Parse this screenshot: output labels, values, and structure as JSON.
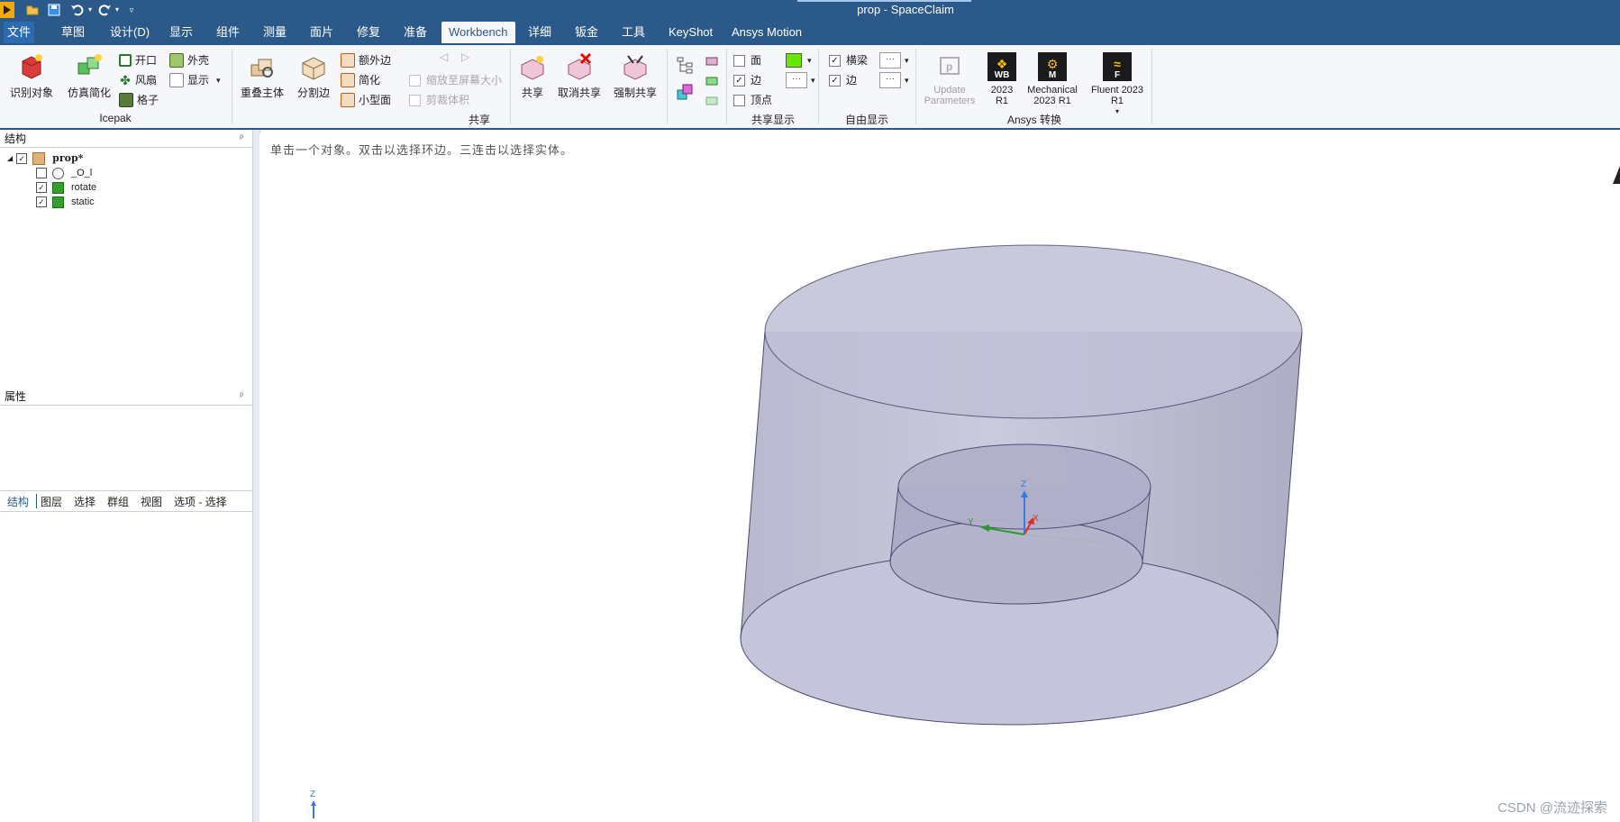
{
  "window": {
    "title": "prop - SpaceClaim"
  },
  "quick_access": [
    "open-icon",
    "save-icon",
    "undo-icon",
    "redo-icon",
    "customize-icon"
  ],
  "menu": {
    "tabs": [
      "文件",
      "草图",
      "设计(D)",
      "显示",
      "组件",
      "测量",
      "面片",
      "修复",
      "准备",
      "Workbench",
      "详细",
      "钣金",
      "工具",
      "KeyShot",
      "Ansys Motion"
    ],
    "active": "Workbench"
  },
  "ribbon": {
    "icepak": {
      "label": "Icepak",
      "identify": "识别对象",
      "simplify": "仿真简化",
      "opening": "开口",
      "fan": "风扇",
      "grille": "格子",
      "enclosure": "外壳",
      "display": "显示"
    },
    "share": {
      "label": "共享",
      "overlap": "重叠主体",
      "split_edge": "分割边",
      "extra_edge": "额外边",
      "simplify": "简化",
      "small_face": "小型面",
      "shrink": "缩放至屏幕大小",
      "clip": "剪裁体积",
      "share": "共享",
      "unshare": "取消共享",
      "force_share": "强制共享"
    },
    "share_display": {
      "label": "共享显示",
      "face": "面",
      "edge": "边",
      "vertex": "顶点",
      "color": "#66e600"
    },
    "free_display": {
      "label": "自由显示",
      "beam": "横梁",
      "edge": "边"
    },
    "ansys": {
      "label": "Ansys 转换",
      "update_line1": "Update",
      "update_line2": "Parameters",
      "wb_line1": "2023",
      "wb_line2": "R1",
      "wb_badge": "WB",
      "mech_line1": "Mechanical",
      "mech_line2": "2023 R1",
      "mech_badge": "M",
      "fluent_line1": "Fluent 2023",
      "fluent_line2": "R1",
      "fluent_badge": "F"
    }
  },
  "structure": {
    "title": "结构",
    "root": "prop*",
    "items": [
      {
        "label": "_O_l",
        "checked": false
      },
      {
        "label": "rotate",
        "checked": true
      },
      {
        "label": "static",
        "checked": true
      }
    ]
  },
  "bottom_tabs": [
    "结构",
    "图层",
    "选择",
    "群组",
    "视图",
    "选项 - 选择"
  ],
  "properties": {
    "title": "属性"
  },
  "viewport": {
    "hint": "单击一个对象。双击以选择环边。三连击以选择实体。",
    "axis_z": "Z",
    "axis_x": "X",
    "axis_y": "Y",
    "corner_z": "Z"
  },
  "watermark": "CSDN @流迹探索"
}
